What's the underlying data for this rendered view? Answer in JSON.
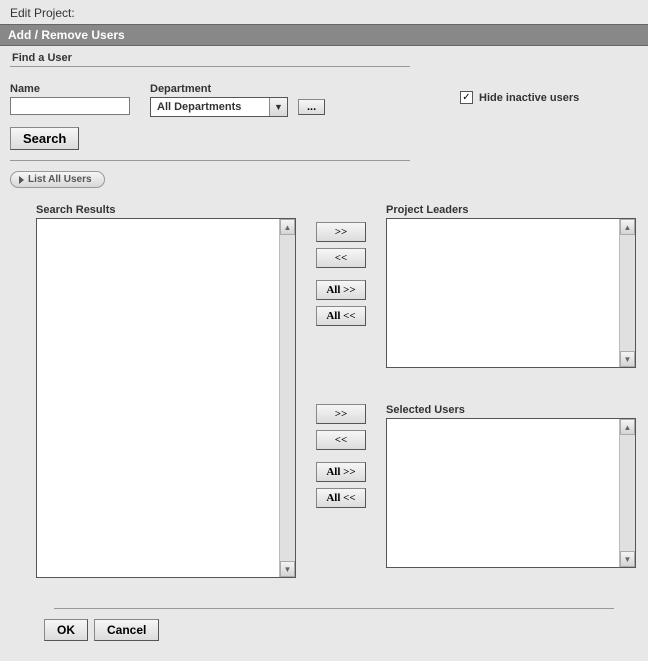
{
  "window": {
    "title": "Edit Project:"
  },
  "header": {
    "title": "Add / Remove Users"
  },
  "find": {
    "section_label": "Find a User",
    "name_label": "Name",
    "name_value": "",
    "department_label": "Department",
    "department_selected": "All Departments",
    "ellipsis": "...",
    "search_label": "Search",
    "list_all_label": "List All Users"
  },
  "hide_inactive": {
    "label": "Hide inactive users",
    "checked": true
  },
  "lists": {
    "search_results_label": "Search Results",
    "project_leaders_label": "Project Leaders",
    "selected_users_label": "Selected Users"
  },
  "move": {
    "add": ">>",
    "remove": "<<",
    "add_all": "All >>",
    "remove_all": "All <<"
  },
  "footer": {
    "ok": "OK",
    "cancel": "Cancel"
  }
}
